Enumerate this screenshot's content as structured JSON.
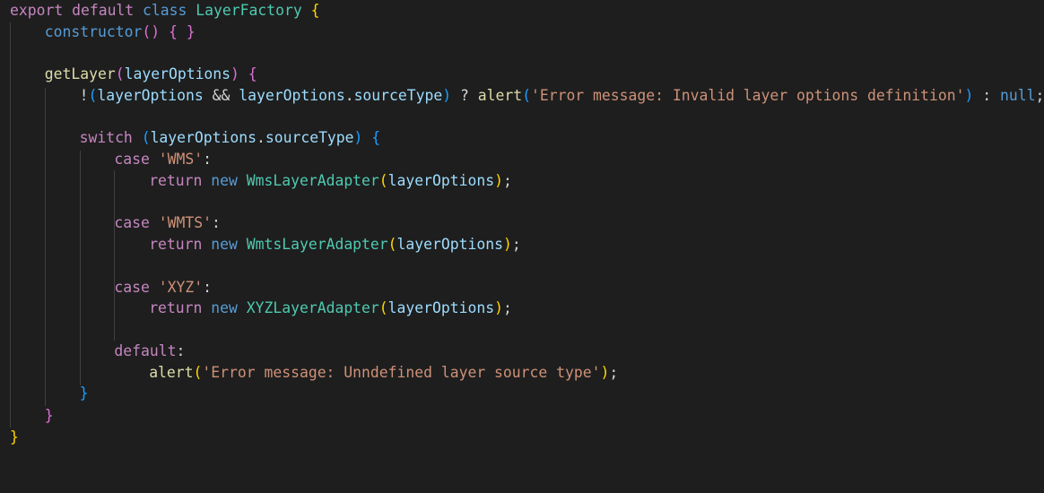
{
  "code": {
    "export_kw": "export",
    "default_kw": "default",
    "class_kw": "class",
    "class_name": "LayerFactory",
    "open_brace": "{",
    "close_brace": "}",
    "constructor_name": "constructor",
    "method_name": "getLayer",
    "param": "layerOptions",
    "amp": "&&",
    "prop_sourceType": "sourceType",
    "alert_fn": "alert",
    "error_invalid": "'Error message: Invalid layer options definition'",
    "null_kw": "null",
    "switch_kw": "switch",
    "case_kw": "case",
    "return_kw": "return",
    "new_kw": "new",
    "default_label": "default",
    "cases": [
      {
        "label": "'WMS'",
        "adapter": "WmsLayerAdapter"
      },
      {
        "label": "'WMTS'",
        "adapter": "WmtsLayerAdapter"
      },
      {
        "label": "'XYZ'",
        "adapter": "XYZLayerAdapter"
      }
    ],
    "error_undefined": "'Error message: Unndefined layer source type'"
  }
}
